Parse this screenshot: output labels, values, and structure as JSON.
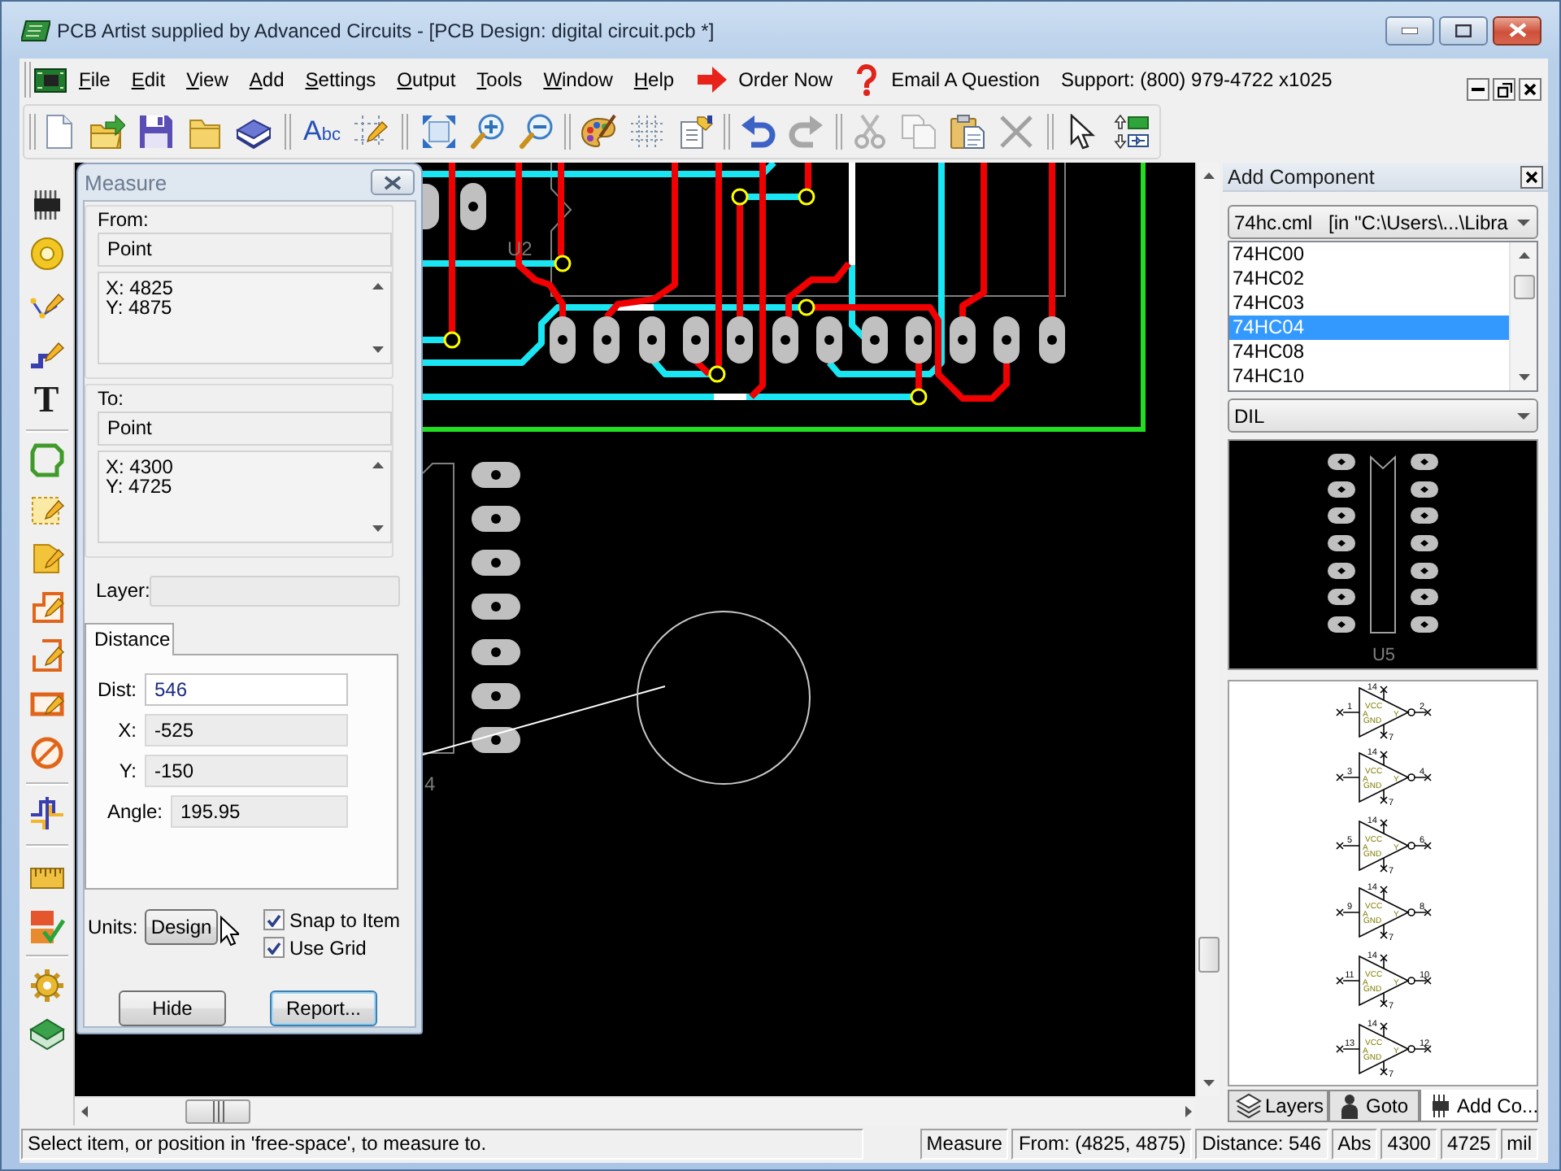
{
  "window": {
    "title": "PCB Artist supplied by Advanced Circuits - [PCB Design: digital circuit.pcb *]"
  },
  "menu_bar": {
    "items": [
      "File",
      "Edit",
      "View",
      "Add",
      "Settings",
      "Output",
      "Tools",
      "Window",
      "Help"
    ],
    "links": [
      {
        "kind": "order",
        "label": "Order Now"
      },
      {
        "kind": "question",
        "label": "Email A Question"
      }
    ],
    "support": "Support: (800) 979-4722 x1025"
  },
  "toolbar": {
    "groups": [
      [
        {
          "disabled": false
        },
        {
          "disabled": false
        },
        {
          "disabled": false
        },
        {
          "disabled": false
        },
        {
          "disabled": false
        }
      ],
      [
        {
          "label": "Abc",
          "disabled": false
        },
        {
          "disabled": false
        }
      ],
      [
        {
          "disabled": false
        },
        {
          "disabled": false
        },
        {
          "disabled": false
        }
      ],
      [
        {
          "disabled": false
        },
        {
          "disabled": false
        },
        {
          "disabled": false
        }
      ],
      [
        {
          "disabled": false
        },
        {
          "disabled": true
        }
      ],
      [
        {
          "disabled": true
        },
        {
          "disabled": true
        },
        {
          "disabled": false
        },
        {
          "disabled": true
        }
      ],
      [
        {
          "disabled": false
        },
        {
          "disabled": false
        }
      ]
    ]
  },
  "tool_strip": {
    "text_tool": "T"
  },
  "measure_dialog": {
    "title": "Measure",
    "points": [
      {
        "label": "From:",
        "type": "Point",
        "coords": [
          "X: 4825",
          "Y: 4875"
        ]
      },
      {
        "label": "To:",
        "type": "Point",
        "coords": [
          "X: 4300",
          "Y: 4725"
        ]
      }
    ],
    "layer_label": "Layer:",
    "tabs": [
      {
        "label": "Distance",
        "selected": true
      }
    ],
    "fields": [
      {
        "label": "Dist:",
        "value": "546",
        "read_only": false
      },
      {
        "label": "X:",
        "value": "-525",
        "read_only": true
      },
      {
        "label": "Y:",
        "value": "-150",
        "read_only": true
      },
      {
        "label": "Angle:",
        "value": "195.95",
        "read_only": true
      }
    ],
    "units_label": "Units:",
    "units_button": "Design",
    "options": [
      {
        "label": "Snap to Item",
        "checked": true
      },
      {
        "label": "Use Grid",
        "checked": true
      }
    ],
    "buttons": [
      {
        "label": "Hide",
        "default": false
      },
      {
        "label": "Report...",
        "default": true
      }
    ]
  },
  "canvas": {
    "labels": [
      {
        "text": "U2"
      },
      {
        "text": "4"
      }
    ]
  },
  "add_component": {
    "title": "Add Component",
    "library": "74hc.cml   [in \"C:\\Users\\...\\Libra",
    "parts": [
      {
        "name": "74HC00",
        "selected": false
      },
      {
        "name": "74HC02",
        "selected": false
      },
      {
        "name": "74HC03",
        "selected": false
      },
      {
        "name": "74HC04",
        "selected": true
      },
      {
        "name": "74HC08",
        "selected": false
      },
      {
        "name": "74HC10",
        "selected": false
      }
    ],
    "package": "DIL",
    "footprint_label": "U5",
    "gates": [
      {
        "in_pin": "1",
        "out_pin": "2",
        "vcc_pin": "14",
        "gnd_pin": "7",
        "in_label": "A",
        "out_label": "Y",
        "vcc_label": "VCC",
        "gnd_label": "GND"
      },
      {
        "in_pin": "3",
        "out_pin": "4",
        "vcc_pin": "14",
        "gnd_pin": "7",
        "in_label": "A",
        "out_label": "Y",
        "vcc_label": "VCC",
        "gnd_label": "GND"
      },
      {
        "in_pin": "5",
        "out_pin": "6",
        "vcc_pin": "14",
        "gnd_pin": "7",
        "in_label": "A",
        "out_label": "Y",
        "vcc_label": "VCC",
        "gnd_label": "GND"
      },
      {
        "in_pin": "9",
        "out_pin": "8",
        "vcc_pin": "14",
        "gnd_pin": "7",
        "in_label": "A",
        "out_label": "Y",
        "vcc_label": "VCC",
        "gnd_label": "GND"
      },
      {
        "in_pin": "11",
        "out_pin": "10",
        "vcc_pin": "14",
        "gnd_pin": "7",
        "in_label": "A",
        "out_label": "Y",
        "vcc_label": "VCC",
        "gnd_label": "GND"
      },
      {
        "in_pin": "13",
        "out_pin": "12",
        "vcc_pin": "14",
        "gnd_pin": "7",
        "in_label": "A",
        "out_label": "Y",
        "vcc_label": "VCC",
        "gnd_label": "GND"
      }
    ],
    "tabs": [
      {
        "label": "Layers",
        "selected": false
      },
      {
        "label": "Goto",
        "selected": false
      },
      {
        "label": "Add Co...",
        "selected": true
      }
    ]
  },
  "status_bar": {
    "message": "Select item, or position in 'free-space', to measure to.",
    "panes": [
      "Measure",
      "From: (4825, 4875)",
      "Distance: 546",
      "Abs",
      "4300",
      "4725",
      "mil"
    ]
  }
}
